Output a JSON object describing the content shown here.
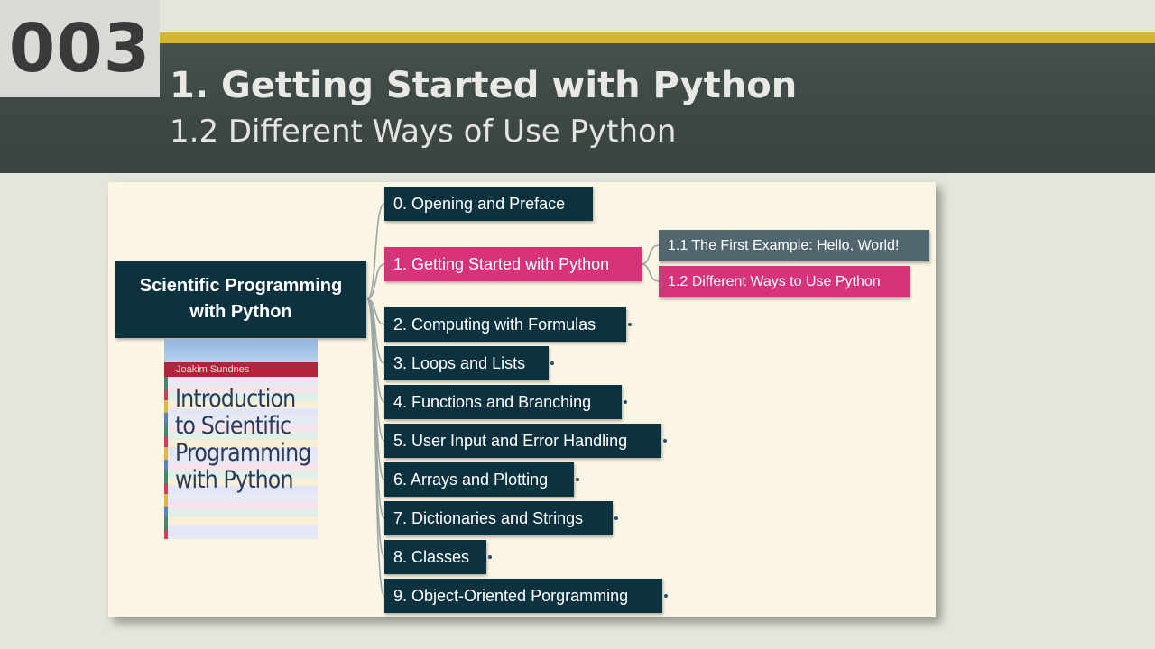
{
  "slide": {
    "number": "003",
    "title": "1. Getting Started with Python",
    "subtitle": "1.2 Different Ways of Use Python"
  },
  "mindmap": {
    "root": {
      "line1": "Scientific Programming",
      "line2": "with Python"
    },
    "book": {
      "author": "Joakim Sundnes",
      "title_lines": [
        "Introduction",
        "to Scientific",
        "Programming",
        "with Python"
      ]
    },
    "chapters": [
      "0. Opening and Preface",
      "1. Getting Started with Python",
      "2. Computing with Formulas",
      "3. Loops and Lists",
      "4. Functions and Branching",
      "5. User Input and Error Handling",
      "6. Arrays and Plotting",
      "7. Dictionaries and Strings",
      "8. Classes",
      "9. Object-Oriented Porgramming"
    ],
    "subtopics": [
      "1.1 The First Example: Hello, World!",
      "1.2 Different Ways to Use Python"
    ],
    "colors": {
      "node": "#0c3240",
      "highlight": "#d6337b",
      "subnode": "#52666f",
      "connector": "#9aa7a6",
      "accent_line": "#d6b531"
    }
  }
}
